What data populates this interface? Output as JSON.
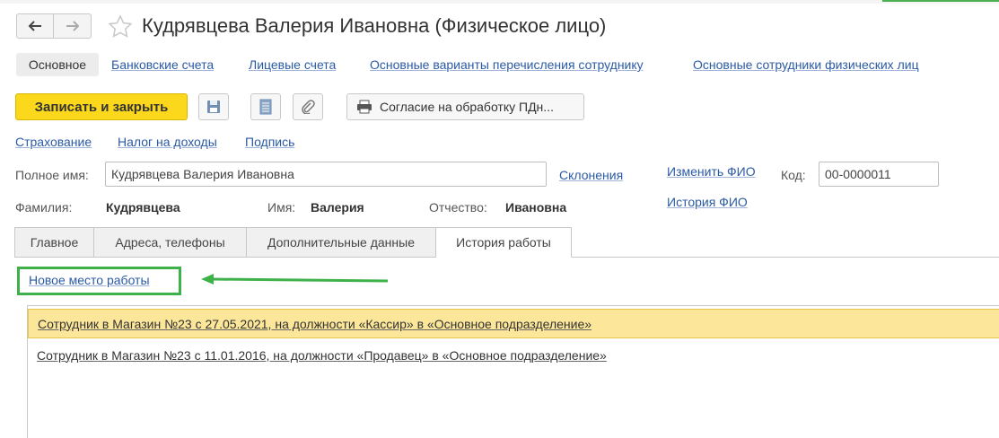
{
  "window": {
    "title": "Кудрявцева Валерия Ивановна (Физическое лицо)"
  },
  "section_tabs": [
    {
      "label": "Основное",
      "active": true
    },
    {
      "label": "Банковские счета"
    },
    {
      "label": "Лицевые счета"
    },
    {
      "label": "Основные варианты перечисления сотруднику"
    },
    {
      "label": "Основные сотрудники физических лиц"
    }
  ],
  "toolbar": {
    "save_close_label": "Записать и закрыть",
    "consent_label": "Согласие на обработку ПДн..."
  },
  "links": {
    "insurance": "Страхование",
    "income_tax": "Налог на доходы",
    "signature": "Подпись",
    "declensions": "Склонения",
    "change_fio": "Изменить ФИО",
    "fio_history": "История ФИО"
  },
  "fields": {
    "full_name_label": "Полное имя:",
    "full_name_value": "Кудрявцева Валерия Ивановна",
    "code_label": "Код:",
    "code_value": "00-0000011",
    "surname_label": "Фамилия:",
    "surname_value": "Кудрявцева",
    "name_label": "Имя:",
    "name_value": "Валерия",
    "patronymic_label": "Отчество:",
    "patronymic_value": "Ивановна"
  },
  "tabs": [
    {
      "label": "Главное"
    },
    {
      "label": "Адреса, телефоны"
    },
    {
      "label": "Дополнительные данные"
    },
    {
      "label": "История работы",
      "active": true
    }
  ],
  "work_history": {
    "new_place_link": "Новое место работы",
    "rows": [
      {
        "text": "Сотрудник в Магазин №23 с 27.05.2021, на должности «Кассир» в «Основное подразделение»",
        "selected": true
      },
      {
        "text": "Сотрудник в Магазин №23 с 11.01.2016, на должности «Продавец» в «Основное подразделение»",
        "selected": false
      }
    ]
  },
  "colors": {
    "accent_yellow": "#fcd81c",
    "link_blue": "#2b5aa5",
    "annotation_green": "#3fb14a",
    "selected_row": "#fce69a"
  }
}
